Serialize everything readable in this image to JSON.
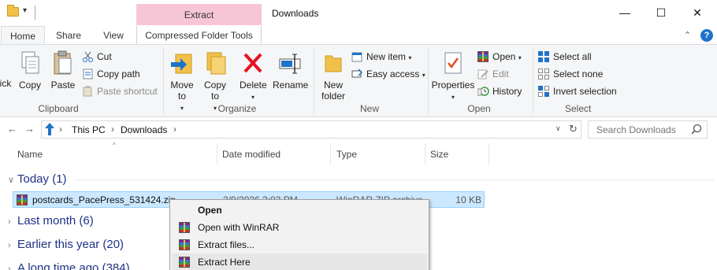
{
  "window": {
    "title": "Downloads",
    "context_tab_header": "Extract",
    "minimize": "—",
    "maximize": "☐",
    "close": "✕"
  },
  "tabs": [
    {
      "label": "Home"
    },
    {
      "label": "Share"
    },
    {
      "label": "View"
    },
    {
      "label": "Compressed Folder Tools"
    }
  ],
  "ribbon": {
    "clipboard": {
      "label": "Clipboard",
      "pin_partial": "ick",
      "copy": "Copy",
      "paste": "Paste",
      "cut": "Cut",
      "copy_path": "Copy path",
      "paste_shortcut": "Paste shortcut"
    },
    "organize": {
      "label": "Organize",
      "move_to": "Move to",
      "copy_to": "Copy to",
      "delete": "Delete",
      "rename": "Rename"
    },
    "new": {
      "label": "New",
      "new_folder": "New folder",
      "new_item": "New item",
      "easy_access": "Easy access"
    },
    "open": {
      "label": "Open",
      "properties": "Properties",
      "open": "Open",
      "edit": "Edit",
      "history": "History"
    },
    "select": {
      "label": "Select",
      "select_all": "Select all",
      "select_none": "Select none",
      "invert_selection": "Invert selection"
    }
  },
  "address": {
    "crumbs": [
      "This PC",
      "Downloads"
    ],
    "search_placeholder": "Search Downloads"
  },
  "columns": {
    "name": "Name",
    "date_modified": "Date modified",
    "type": "Type",
    "size": "Size"
  },
  "groups": {
    "today": "Today (1)",
    "last_month": "Last month (6)",
    "earlier_this_year": "Earlier this year (20)",
    "long_time_ago": "A long time ago (384)"
  },
  "file": {
    "name": "postcards_PacePress_531424.zip",
    "date": "3/9/2026 3:03 PM",
    "type": "WinRAR ZIP archive",
    "size": "10 KB"
  },
  "context_menu": [
    {
      "label": "Open"
    },
    {
      "label": "Open with WinRAR"
    },
    {
      "label": "Extract files..."
    },
    {
      "label": "Extract Here"
    }
  ],
  "colors": {
    "extract_tab": "#f7c6d6",
    "selection": "#cce8ff",
    "group_text": "#1e3287"
  }
}
